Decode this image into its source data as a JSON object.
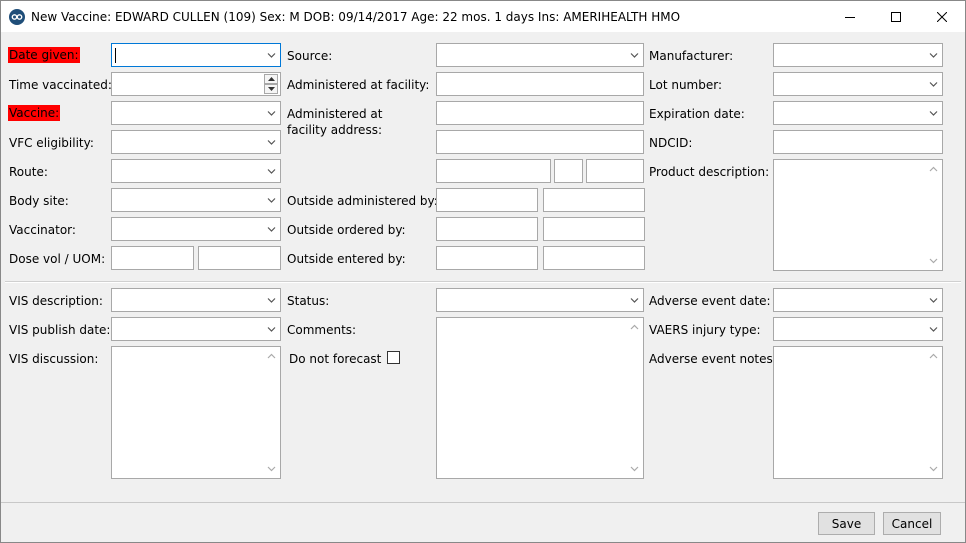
{
  "window": {
    "title": "New Vaccine: EDWARD CULLEN (109)  Sex: M  DOB: 09/14/2017  Age: 22 mos. 1 days  Ins: AMERIHEALTH HMO",
    "app_icon": "cp-logo-icon",
    "controls": [
      "minimize-icon",
      "maximize-icon",
      "close-icon"
    ]
  },
  "labels": {
    "date_given": "Date given:",
    "time_vaccinated": "Time vaccinated:",
    "vaccine": "Vaccine:",
    "vfc_eligibility": "VFC eligibility:",
    "route": "Route:",
    "body_site": "Body site:",
    "vaccinator": "Vaccinator:",
    "dose_vol_uom": "Dose vol / UOM:",
    "source": "Source:",
    "administered_at_facility": "Administered at facility:",
    "administered_at_facility_address_1": "Administered at",
    "administered_at_facility_address_2": "facility address:",
    "outside_administered_by": "Outside administered by:",
    "outside_ordered_by": "Outside ordered by:",
    "outside_entered_by": "Outside entered by:",
    "manufacturer": "Manufacturer:",
    "lot_number": "Lot number:",
    "expiration_date": "Expiration date:",
    "ndcid": "NDCID:",
    "product_description": "Product description:",
    "vis_description": "VIS description:",
    "vis_publish_date": "VIS publish date:",
    "vis_discussion": "VIS discussion:",
    "status": "Status:",
    "comments": "Comments:",
    "do_not_forecast": "Do not forecast",
    "adverse_event_date": "Adverse event date:",
    "vaers_injury_type": "VAERS injury type:",
    "adverse_event_notes": "Adverse event notes:"
  },
  "values": {
    "date_given": "",
    "time_vaccinated": "",
    "vaccine": "",
    "do_not_forecast_checked": false
  },
  "buttons": {
    "save": "Save",
    "cancel": "Cancel"
  },
  "colors": {
    "required_highlight": "#ff0000",
    "focus_border": "#0078d7"
  }
}
